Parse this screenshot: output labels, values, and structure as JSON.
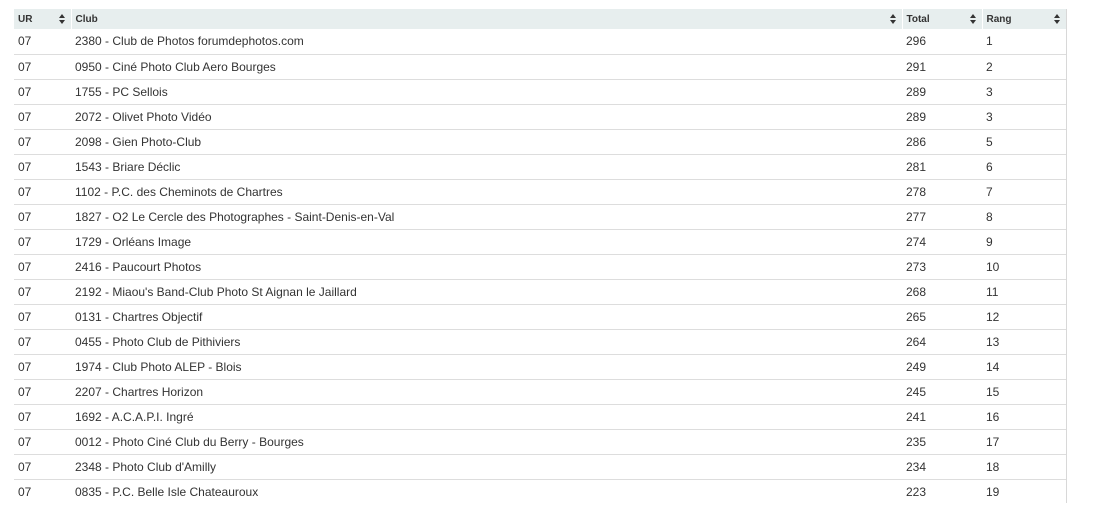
{
  "table": {
    "columns": [
      {
        "key": "ur",
        "label": "UR"
      },
      {
        "key": "club",
        "label": "Club"
      },
      {
        "key": "total",
        "label": "Total"
      },
      {
        "key": "rang",
        "label": "Rang"
      }
    ],
    "rows": [
      {
        "ur": "07",
        "club": "2380 - Club de Photos forumdephotos.com",
        "total": "296",
        "rang": "1"
      },
      {
        "ur": "07",
        "club": "0950 - Ciné Photo Club Aero Bourges",
        "total": "291",
        "rang": "2"
      },
      {
        "ur": "07",
        "club": "1755 - PC Sellois",
        "total": "289",
        "rang": "3"
      },
      {
        "ur": "07",
        "club": "2072 - Olivet Photo Vidéo",
        "total": "289",
        "rang": "3"
      },
      {
        "ur": "07",
        "club": "2098 - Gien Photo-Club",
        "total": "286",
        "rang": "5"
      },
      {
        "ur": "07",
        "club": "1543 - Briare Déclic",
        "total": "281",
        "rang": "6"
      },
      {
        "ur": "07",
        "club": "1102 - P.C. des Cheminots de Chartres",
        "total": "278",
        "rang": "7"
      },
      {
        "ur": "07",
        "club": "1827 - O2 Le Cercle des Photographes - Saint-Denis-en-Val",
        "total": "277",
        "rang": "8"
      },
      {
        "ur": "07",
        "club": "1729 - Orléans Image",
        "total": "274",
        "rang": "9"
      },
      {
        "ur": "07",
        "club": "2416 - Paucourt Photos",
        "total": "273",
        "rang": "10"
      },
      {
        "ur": "07",
        "club": "2192 - Miaou's Band-Club Photo St Aignan le Jaillard",
        "total": "268",
        "rang": "11"
      },
      {
        "ur": "07",
        "club": "0131 - Chartres Objectif",
        "total": "265",
        "rang": "12"
      },
      {
        "ur": "07",
        "club": "0455 - Photo Club de Pithiviers",
        "total": "264",
        "rang": "13"
      },
      {
        "ur": "07",
        "club": "1974 - Club Photo ALEP - Blois",
        "total": "249",
        "rang": "14"
      },
      {
        "ur": "07",
        "club": "2207 - Chartres Horizon",
        "total": "245",
        "rang": "15"
      },
      {
        "ur": "07",
        "club": "1692 - A.C.A.P.I. Ingré",
        "total": "241",
        "rang": "16"
      },
      {
        "ur": "07",
        "club": "0012 - Photo Ciné Club du Berry - Bourges",
        "total": "235",
        "rang": "17"
      },
      {
        "ur": "07",
        "club": "2348 - Photo Club d'Amilly",
        "total": "234",
        "rang": "18"
      },
      {
        "ur": "07",
        "club": "0835 - P.C. Belle Isle Chateauroux",
        "total": "223",
        "rang": "19"
      }
    ]
  },
  "icons": {
    "sort": "sort-both-icon"
  },
  "colors": {
    "header_bg": "#e7eeee",
    "row_border": "#dddddd",
    "text": "#333333"
  }
}
